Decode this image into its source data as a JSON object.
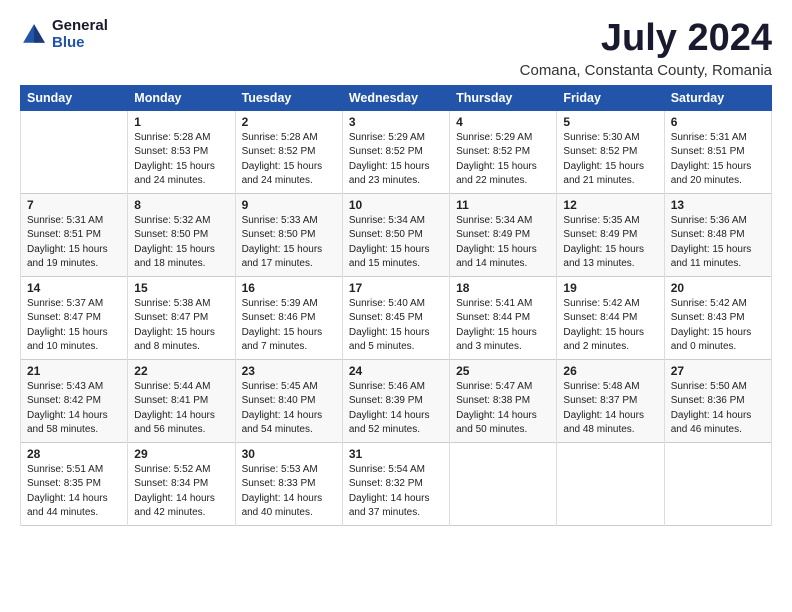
{
  "logo": {
    "general": "General",
    "blue": "Blue"
  },
  "title": "July 2024",
  "location": "Comana, Constanta County, Romania",
  "days_header": [
    "Sunday",
    "Monday",
    "Tuesday",
    "Wednesday",
    "Thursday",
    "Friday",
    "Saturday"
  ],
  "weeks": [
    [
      {
        "num": "",
        "info": ""
      },
      {
        "num": "1",
        "info": "Sunrise: 5:28 AM\nSunset: 8:53 PM\nDaylight: 15 hours\nand 24 minutes."
      },
      {
        "num": "2",
        "info": "Sunrise: 5:28 AM\nSunset: 8:52 PM\nDaylight: 15 hours\nand 24 minutes."
      },
      {
        "num": "3",
        "info": "Sunrise: 5:29 AM\nSunset: 8:52 PM\nDaylight: 15 hours\nand 23 minutes."
      },
      {
        "num": "4",
        "info": "Sunrise: 5:29 AM\nSunset: 8:52 PM\nDaylight: 15 hours\nand 22 minutes."
      },
      {
        "num": "5",
        "info": "Sunrise: 5:30 AM\nSunset: 8:52 PM\nDaylight: 15 hours\nand 21 minutes."
      },
      {
        "num": "6",
        "info": "Sunrise: 5:31 AM\nSunset: 8:51 PM\nDaylight: 15 hours\nand 20 minutes."
      }
    ],
    [
      {
        "num": "7",
        "info": "Sunrise: 5:31 AM\nSunset: 8:51 PM\nDaylight: 15 hours\nand 19 minutes."
      },
      {
        "num": "8",
        "info": "Sunrise: 5:32 AM\nSunset: 8:50 PM\nDaylight: 15 hours\nand 18 minutes."
      },
      {
        "num": "9",
        "info": "Sunrise: 5:33 AM\nSunset: 8:50 PM\nDaylight: 15 hours\nand 17 minutes."
      },
      {
        "num": "10",
        "info": "Sunrise: 5:34 AM\nSunset: 8:50 PM\nDaylight: 15 hours\nand 15 minutes."
      },
      {
        "num": "11",
        "info": "Sunrise: 5:34 AM\nSunset: 8:49 PM\nDaylight: 15 hours\nand 14 minutes."
      },
      {
        "num": "12",
        "info": "Sunrise: 5:35 AM\nSunset: 8:49 PM\nDaylight: 15 hours\nand 13 minutes."
      },
      {
        "num": "13",
        "info": "Sunrise: 5:36 AM\nSunset: 8:48 PM\nDaylight: 15 hours\nand 11 minutes."
      }
    ],
    [
      {
        "num": "14",
        "info": "Sunrise: 5:37 AM\nSunset: 8:47 PM\nDaylight: 15 hours\nand 10 minutes."
      },
      {
        "num": "15",
        "info": "Sunrise: 5:38 AM\nSunset: 8:47 PM\nDaylight: 15 hours\nand 8 minutes."
      },
      {
        "num": "16",
        "info": "Sunrise: 5:39 AM\nSunset: 8:46 PM\nDaylight: 15 hours\nand 7 minutes."
      },
      {
        "num": "17",
        "info": "Sunrise: 5:40 AM\nSunset: 8:45 PM\nDaylight: 15 hours\nand 5 minutes."
      },
      {
        "num": "18",
        "info": "Sunrise: 5:41 AM\nSunset: 8:44 PM\nDaylight: 15 hours\nand 3 minutes."
      },
      {
        "num": "19",
        "info": "Sunrise: 5:42 AM\nSunset: 8:44 PM\nDaylight: 15 hours\nand 2 minutes."
      },
      {
        "num": "20",
        "info": "Sunrise: 5:42 AM\nSunset: 8:43 PM\nDaylight: 15 hours\nand 0 minutes."
      }
    ],
    [
      {
        "num": "21",
        "info": "Sunrise: 5:43 AM\nSunset: 8:42 PM\nDaylight: 14 hours\nand 58 minutes."
      },
      {
        "num": "22",
        "info": "Sunrise: 5:44 AM\nSunset: 8:41 PM\nDaylight: 14 hours\nand 56 minutes."
      },
      {
        "num": "23",
        "info": "Sunrise: 5:45 AM\nSunset: 8:40 PM\nDaylight: 14 hours\nand 54 minutes."
      },
      {
        "num": "24",
        "info": "Sunrise: 5:46 AM\nSunset: 8:39 PM\nDaylight: 14 hours\nand 52 minutes."
      },
      {
        "num": "25",
        "info": "Sunrise: 5:47 AM\nSunset: 8:38 PM\nDaylight: 14 hours\nand 50 minutes."
      },
      {
        "num": "26",
        "info": "Sunrise: 5:48 AM\nSunset: 8:37 PM\nDaylight: 14 hours\nand 48 minutes."
      },
      {
        "num": "27",
        "info": "Sunrise: 5:50 AM\nSunset: 8:36 PM\nDaylight: 14 hours\nand 46 minutes."
      }
    ],
    [
      {
        "num": "28",
        "info": "Sunrise: 5:51 AM\nSunset: 8:35 PM\nDaylight: 14 hours\nand 44 minutes."
      },
      {
        "num": "29",
        "info": "Sunrise: 5:52 AM\nSunset: 8:34 PM\nDaylight: 14 hours\nand 42 minutes."
      },
      {
        "num": "30",
        "info": "Sunrise: 5:53 AM\nSunset: 8:33 PM\nDaylight: 14 hours\nand 40 minutes."
      },
      {
        "num": "31",
        "info": "Sunrise: 5:54 AM\nSunset: 8:32 PM\nDaylight: 14 hours\nand 37 minutes."
      },
      {
        "num": "",
        "info": ""
      },
      {
        "num": "",
        "info": ""
      },
      {
        "num": "",
        "info": ""
      }
    ]
  ]
}
